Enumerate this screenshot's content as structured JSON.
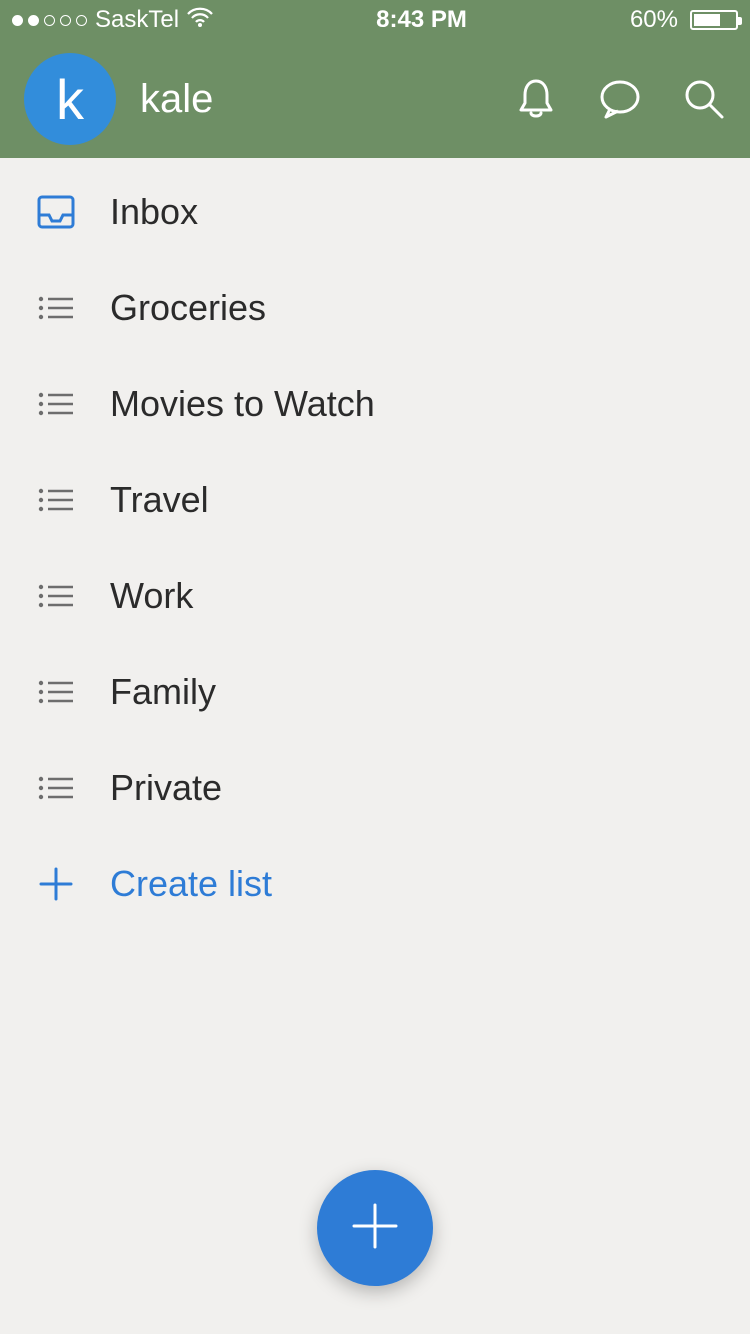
{
  "status_bar": {
    "carrier": "SaskTel",
    "time": "8:43 PM",
    "battery_pct": "60%"
  },
  "header": {
    "avatar_initial": "k",
    "username": "kale"
  },
  "lists": [
    {
      "id": "inbox",
      "label": "Inbox",
      "icon": "inbox"
    },
    {
      "id": "groceries",
      "label": "Groceries",
      "icon": "list"
    },
    {
      "id": "movies",
      "label": "Movies to Watch",
      "icon": "list"
    },
    {
      "id": "travel",
      "label": "Travel",
      "icon": "list"
    },
    {
      "id": "work",
      "label": "Work",
      "icon": "list"
    },
    {
      "id": "family",
      "label": "Family",
      "icon": "list"
    },
    {
      "id": "private",
      "label": "Private",
      "icon": "list"
    }
  ],
  "create_list_label": "Create list",
  "colors": {
    "header_bg": "#6e8f65",
    "accent_blue": "#2e7cd6",
    "page_bg": "#f1f0ee"
  }
}
